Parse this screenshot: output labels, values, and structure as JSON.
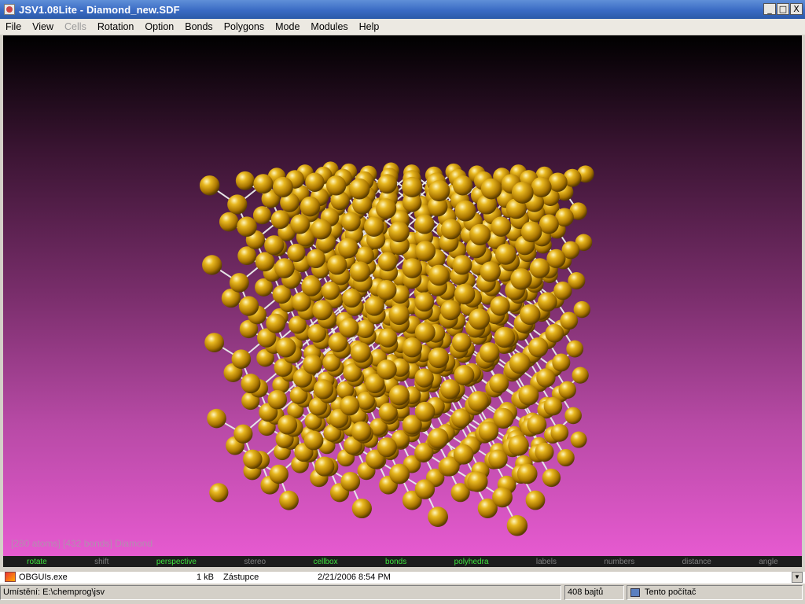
{
  "window": {
    "title": "JSV1.08Lite - Diamond_new.SDF",
    "buttons": [
      "_",
      "□",
      "X"
    ]
  },
  "menu": [
    {
      "label": "File",
      "enabled": true
    },
    {
      "label": "View",
      "enabled": true
    },
    {
      "label": "Cells",
      "enabled": false
    },
    {
      "label": "Rotation",
      "enabled": true
    },
    {
      "label": "Option",
      "enabled": true
    },
    {
      "label": "Bonds",
      "enabled": true
    },
    {
      "label": "Polygons",
      "enabled": true
    },
    {
      "label": "Mode",
      "enabled": true
    },
    {
      "label": "Modules",
      "enabled": true
    },
    {
      "label": "Help",
      "enabled": true
    }
  ],
  "viewer": {
    "status_text": "[280 atoms] [432 bonds] Diamond",
    "atom_color": "#d4a017",
    "bond_color": "#e6e6e6",
    "background_top": "#000000",
    "background_bottom": "#e65ad0"
  },
  "modes": [
    {
      "label": "rotate",
      "active": true
    },
    {
      "label": "shift",
      "active": false
    },
    {
      "label": "perspective",
      "active": true
    },
    {
      "label": "stereo",
      "active": false
    },
    {
      "label": "cellbox",
      "active": true
    },
    {
      "label": "bonds",
      "active": true
    },
    {
      "label": "polyhedra",
      "active": true
    },
    {
      "label": "labels",
      "active": false
    },
    {
      "label": "numbers",
      "active": false
    },
    {
      "label": "distance",
      "active": false
    },
    {
      "label": "angle",
      "active": false
    }
  ],
  "file_row": {
    "name": "OBGUIs.exe",
    "size": "1 kB",
    "type": "Zástupce",
    "date": "2/21/2006 8:54 PM"
  },
  "statusbar": {
    "location": "Umístění: E:\\chemprog\\jsv",
    "size": "408 bajtů",
    "computer": "Tento počítač"
  }
}
